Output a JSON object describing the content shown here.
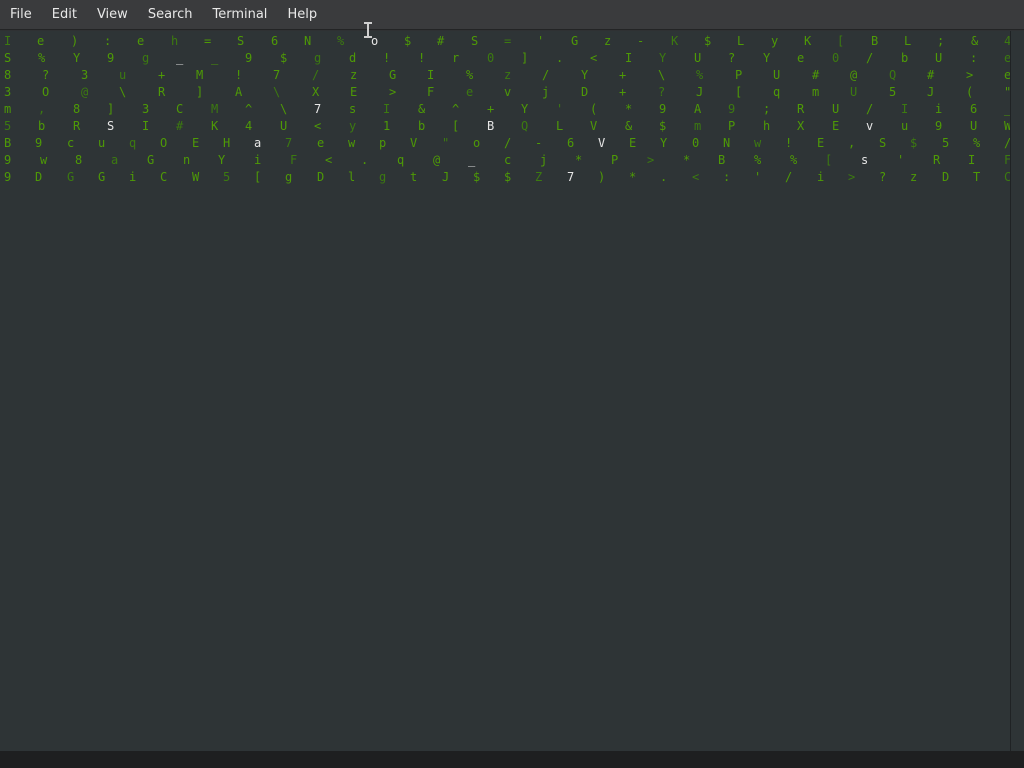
{
  "menubar": {
    "items": [
      {
        "label": "File"
      },
      {
        "label": "Edit"
      },
      {
        "label": "View"
      },
      {
        "label": "Search"
      },
      {
        "label": "Terminal"
      },
      {
        "label": "Help"
      }
    ]
  },
  "colors": {
    "terminal_background": "#2e3436",
    "glyph_green": "#4e9a06",
    "glyph_bright": "#e6e6e6",
    "menubar_background": "#3a3b3d",
    "menu_text": "#e8e8e8"
  },
  "terminal": {
    "rows": [
      [
        "I",
        "e",
        ")",
        ":",
        "e",
        "h",
        "=",
        "S",
        "6",
        "N",
        "%",
        "o",
        "$",
        "#",
        "S",
        "=",
        "'",
        "G",
        "z",
        "-",
        "K",
        "$",
        "L",
        "y",
        "K",
        "[",
        "B",
        "L",
        ";",
        "&",
        "4"
      ],
      [
        "S",
        "%",
        "Y",
        "9",
        "g",
        "_",
        "_",
        "9",
        "$",
        "g",
        "d",
        "!",
        "!",
        "r",
        "0",
        "]",
        ".",
        "<",
        "I",
        "Y",
        "U",
        "?",
        "Y",
        "e",
        "0",
        "/",
        "b",
        "U",
        ":",
        "e"
      ],
      [
        "8",
        "?",
        "3",
        "u",
        "+",
        "M",
        "!",
        "7",
        "/",
        "z",
        "G",
        "I",
        "%",
        "z",
        "/",
        "Y",
        "+",
        "\\",
        "%",
        "P",
        "U",
        "#",
        "@",
        "Q",
        "#",
        ">",
        "e"
      ],
      [
        "3",
        "O",
        "@",
        "\\",
        "R",
        "]",
        "A",
        "\\",
        "X",
        "E",
        ">",
        "F",
        "e",
        "v",
        "j",
        "D",
        "+",
        "?",
        "J",
        "[",
        "q",
        "m",
        "U",
        "5",
        "J",
        "(",
        "\""
      ],
      [
        "m",
        ",",
        "8",
        "]",
        "3",
        "C",
        "M",
        "^",
        "\\",
        "7",
        "s",
        "I",
        "&",
        "^",
        "+",
        "Y",
        "'",
        "(",
        "*",
        "9",
        "A",
        "9",
        ";",
        "R",
        "U",
        "/",
        "I",
        "i",
        "6",
        "_"
      ],
      [
        "5",
        "b",
        "R",
        "S",
        "I",
        "#",
        "K",
        "4",
        "U",
        "<",
        "y",
        "1",
        "b",
        "[",
        "B",
        "Q",
        "L",
        "V",
        "&",
        "$",
        "m",
        "P",
        "h",
        "X",
        "E",
        "v",
        "u",
        "9",
        "U",
        "W"
      ],
      [
        "B",
        "9",
        "c",
        "u",
        "q",
        "O",
        "E",
        "H",
        "a",
        "7",
        "e",
        "w",
        "p",
        "V",
        "\"",
        "o",
        "/",
        "-",
        "6",
        "V",
        "E",
        "Y",
        "0",
        "N",
        "w",
        "!",
        "E",
        ",",
        "S",
        "$",
        "5",
        "%",
        "/"
      ],
      [
        "9",
        "w",
        "8",
        "a",
        "G",
        "n",
        "Y",
        "i",
        "F",
        "<",
        ".",
        "q",
        "@",
        "_",
        "c",
        "j",
        "*",
        "P",
        ">",
        "*",
        "B",
        "%",
        "%",
        "[",
        "s",
        "'",
        "R",
        "I",
        "F"
      ],
      [
        "9",
        "D",
        "G",
        "G",
        "i",
        "C",
        "W",
        "5",
        "[",
        "g",
        "D",
        "l",
        "g",
        "t",
        "J",
        "$",
        "$",
        "Z",
        "7",
        ")",
        "*",
        ".",
        "<",
        ":",
        "'",
        "/",
        "i",
        ">",
        "?",
        "z",
        "D",
        "T",
        "C"
      ]
    ]
  }
}
